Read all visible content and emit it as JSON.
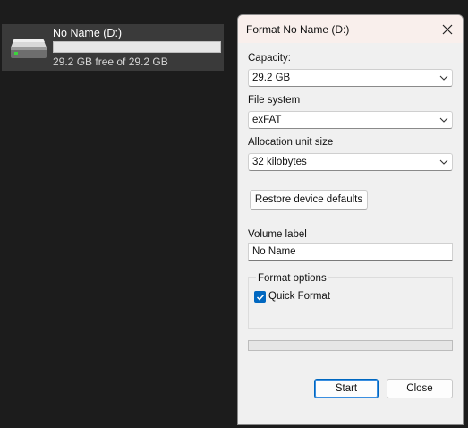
{
  "drive": {
    "name": "No Name (D:)",
    "free_text": "29.2 GB free of 29.2 GB",
    "used_fraction": 0.0,
    "icon": "hard-drive-icon"
  },
  "dialog": {
    "title": "Format No Name (D:)",
    "capacity": {
      "label": "Capacity:",
      "value": "29.2 GB"
    },
    "file_system": {
      "label": "File system",
      "value": "exFAT"
    },
    "allocation": {
      "label": "Allocation unit size",
      "value": "32 kilobytes"
    },
    "restore_label": "Restore device defaults",
    "volume": {
      "label": "Volume label",
      "value": "No Name"
    },
    "format_options": {
      "title": "Format options",
      "quick_format": "Quick Format",
      "quick_checked": true
    },
    "progress_fraction": 0.0,
    "start_label": "Start",
    "close_label": "Close"
  },
  "colors": {
    "accent": "#0067c0",
    "progress": "#06b025",
    "drive_bar": "#26a0da"
  }
}
